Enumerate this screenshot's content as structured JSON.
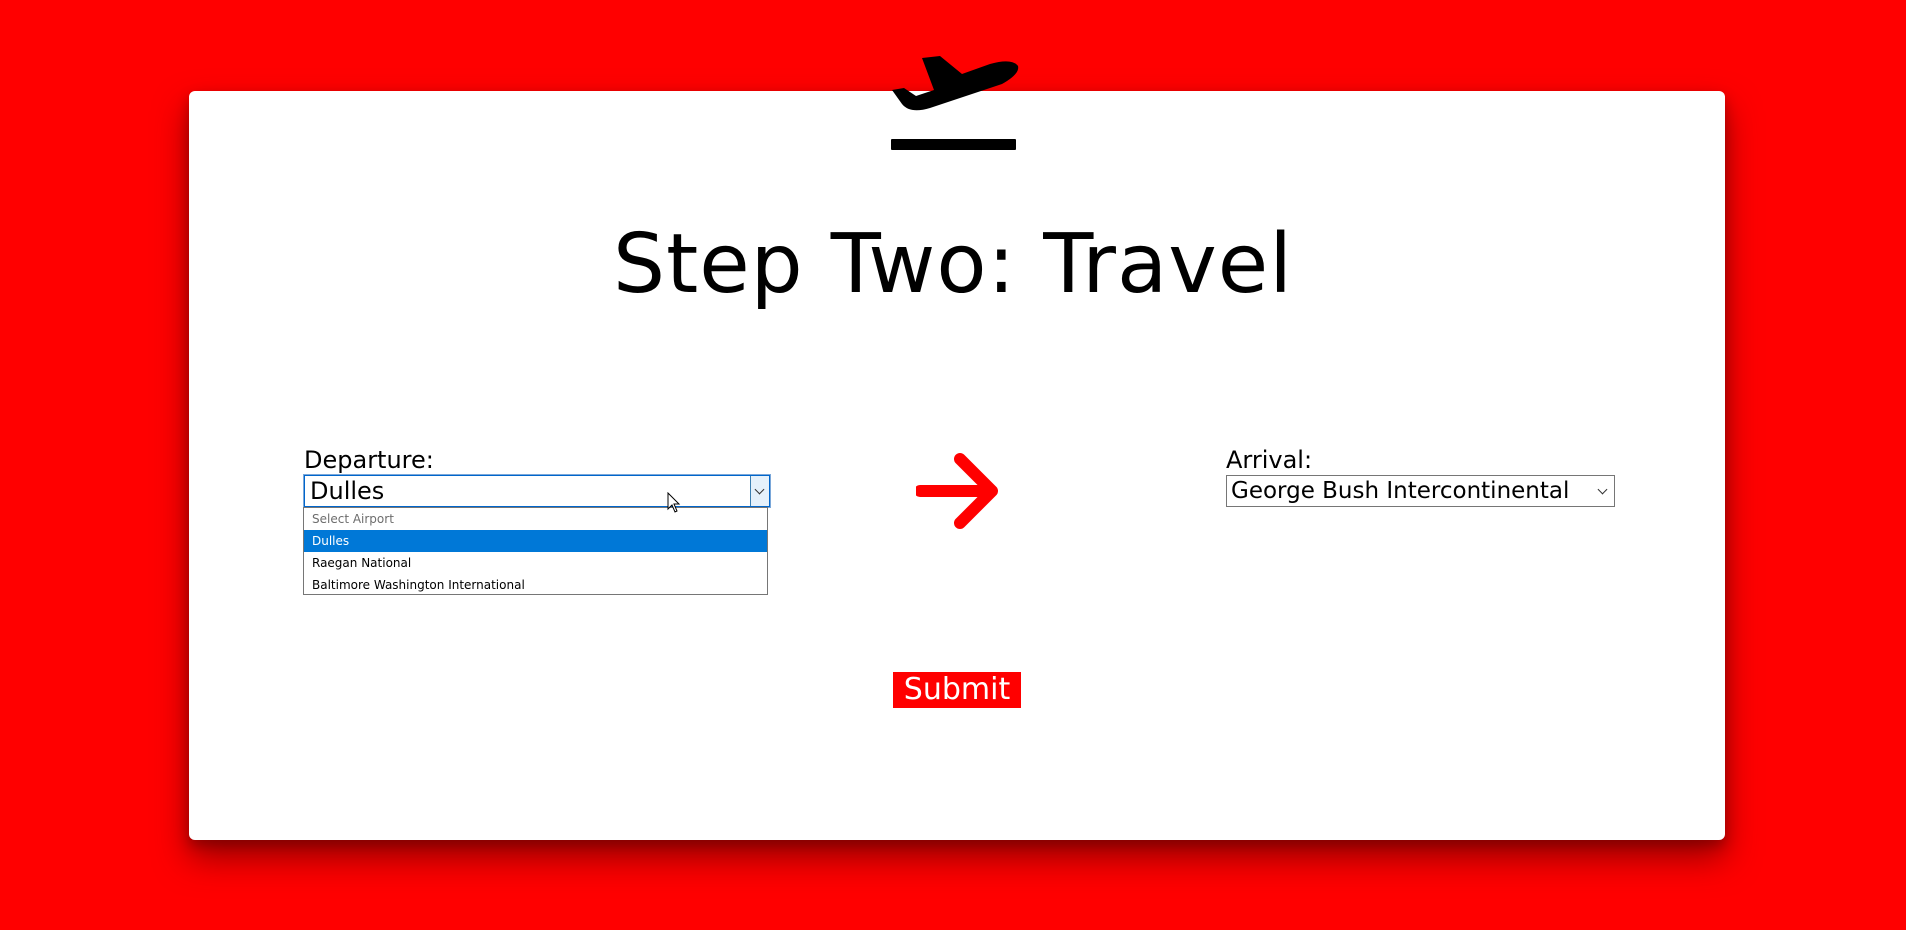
{
  "page": {
    "title": "Step Two: Travel",
    "background_color": "#ff0000",
    "card_color": "#ffffff"
  },
  "header_icon": "airplane-departure-icon",
  "departure": {
    "label": "Departure:",
    "selected_value": "Dulles",
    "dropdown_open": true,
    "options": [
      {
        "label": "Select Airport",
        "placeholder": true
      },
      {
        "label": "Dulles",
        "selected": true
      },
      {
        "label": "Raegan National"
      },
      {
        "label": "Baltimore Washington International"
      }
    ]
  },
  "direction_icon": "arrow-right-icon",
  "arrival": {
    "label": "Arrival:",
    "selected_value": "George Bush Intercontinental"
  },
  "submit": {
    "label": "Submit",
    "color": "#ff0000"
  },
  "selection_highlight_color": "#0078d7"
}
